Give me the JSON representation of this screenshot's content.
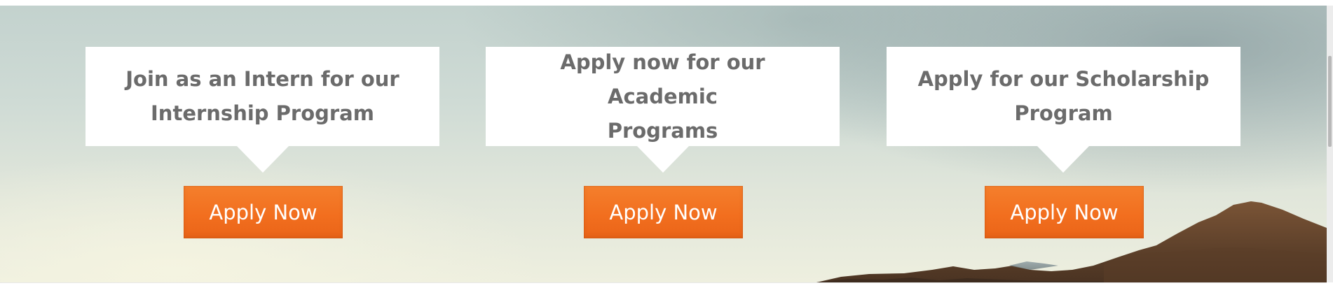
{
  "cards": [
    {
      "line1": "Join as an Intern for our",
      "line2": "Internship Program",
      "button_label": "Apply Now"
    },
    {
      "line1": "Apply now for our Academic",
      "line2": "Programs",
      "button_label": "Apply Now"
    },
    {
      "line1": "Apply for our Scholarship",
      "line2": "Program",
      "button_label": "Apply Now"
    }
  ],
  "colors": {
    "button": "#f26f1f",
    "card_background": "#ffffff",
    "heading_text": "#6b6b6b",
    "button_text": "#ffffff"
  },
  "icons": {
    "card_pointer": "triangle-down"
  }
}
